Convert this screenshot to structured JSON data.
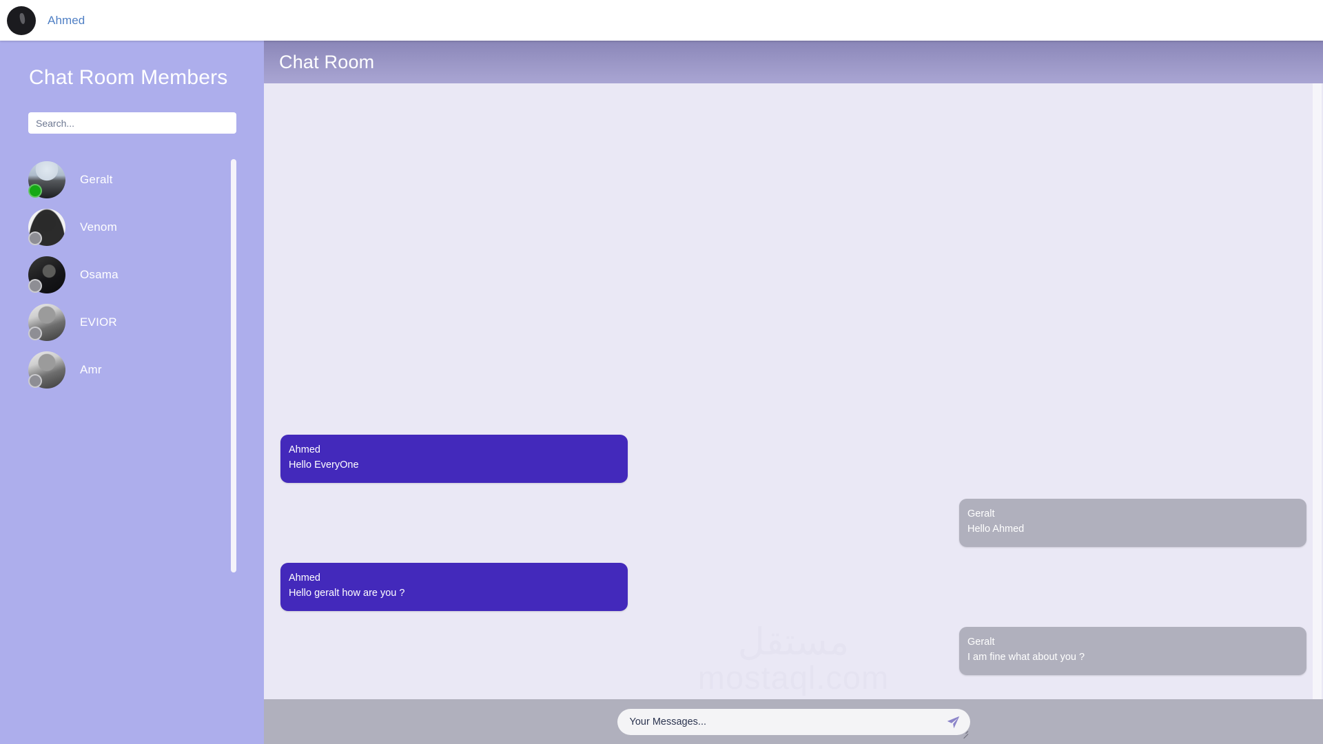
{
  "navbar": {
    "username": "Ahmed",
    "avatar_icon": "user-avatar"
  },
  "sidebar": {
    "title": "Chat Room Members",
    "search": {
      "placeholder": "Search...",
      "value": ""
    },
    "members": [
      {
        "name": "Geralt",
        "status": "online",
        "avatar_icon": "avatar-geralt"
      },
      {
        "name": "Venom",
        "status": "offline",
        "avatar_icon": "avatar-venom"
      },
      {
        "name": "Osama",
        "status": "offline",
        "avatar_icon": "avatar-osama"
      },
      {
        "name": "EVIOR",
        "status": "offline",
        "avatar_icon": "avatar-evior"
      },
      {
        "name": "Amr",
        "status": "offline",
        "avatar_icon": "avatar-amr"
      }
    ]
  },
  "chat": {
    "header_title": "Chat Room",
    "messages": [
      {
        "sender": "Ahmed",
        "text": "Hello EveryOne",
        "direction": "sent"
      },
      {
        "sender": "Geralt",
        "text": "Hello Ahmed",
        "direction": "received"
      },
      {
        "sender": "Ahmed",
        "text": "Hello geralt how are you ?",
        "direction": "sent"
      },
      {
        "sender": "Geralt",
        "text": "I am fine what about you ?",
        "direction": "received"
      }
    ],
    "composer": {
      "placeholder": "Your Messages...",
      "value": "",
      "send_icon": "paper-plane-icon"
    }
  },
  "watermark": {
    "arabic": "مستقل",
    "latin": "mostaql.com"
  },
  "colors": {
    "sidebar_bg": "#adaeec",
    "chat_bg": "#eae8f5",
    "header_gradient_top": "#8a86b8",
    "header_gradient_bottom": "#a9a5d3",
    "sent_bubble": "#4329bb",
    "received_bubble": "#b0b0bd",
    "composer_bar": "#b0b0bd",
    "online_dot": "#15a815",
    "offline_dot": "#8e8e94",
    "nav_username": "#4f7fc4",
    "send_icon": "#8b84c9"
  }
}
